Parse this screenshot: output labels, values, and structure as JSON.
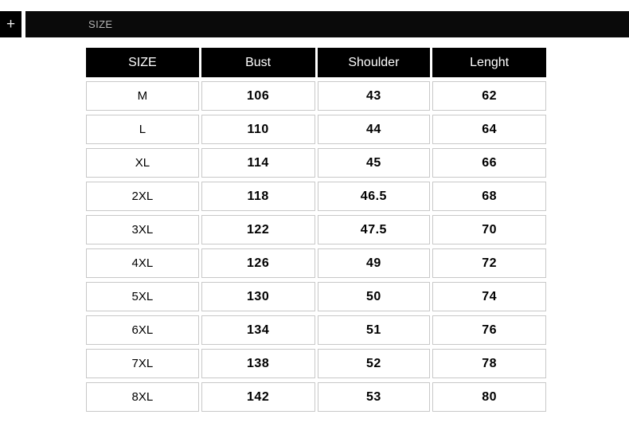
{
  "topbar": {
    "add_button_label": "+",
    "add_button_icon": "plus-icon",
    "section_label": "SIZE",
    "bar_color": "#0a0a0a",
    "label_color": "#b4b4b4"
  },
  "size_table": {
    "headers": [
      "SIZE",
      "Bust",
      "Shoulder",
      "Lenght"
    ],
    "header_background": "#000000",
    "header_text_color": "#ffffff",
    "cell_border_color": "#c8c8c8",
    "rows": [
      {
        "size": "M",
        "bust": "106",
        "shoulder": "43",
        "lenght": "62"
      },
      {
        "size": "L",
        "bust": "110",
        "shoulder": "44",
        "lenght": "64"
      },
      {
        "size": "XL",
        "bust": "114",
        "shoulder": "45",
        "lenght": "66"
      },
      {
        "size": "2XL",
        "bust": "118",
        "shoulder": "46.5",
        "lenght": "68"
      },
      {
        "size": "3XL",
        "bust": "122",
        "shoulder": "47.5",
        "lenght": "70"
      },
      {
        "size": "4XL",
        "bust": "126",
        "shoulder": "49",
        "lenght": "72"
      },
      {
        "size": "5XL",
        "bust": "130",
        "shoulder": "50",
        "lenght": "74"
      },
      {
        "size": "6XL",
        "bust": "134",
        "shoulder": "51",
        "lenght": "76"
      },
      {
        "size": "7XL",
        "bust": "138",
        "shoulder": "52",
        "lenght": "78"
      },
      {
        "size": "8XL",
        "bust": "142",
        "shoulder": "53",
        "lenght": "80"
      }
    ]
  }
}
